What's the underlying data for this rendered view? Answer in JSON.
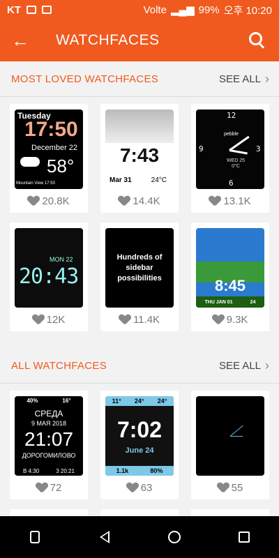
{
  "status": {
    "carrier": "KT",
    "network": "Volte",
    "battery": "99%",
    "time": "오후 10:20"
  },
  "appbar": {
    "title": "WATCHFACES",
    "back_icon": "arrow-left-icon",
    "search_icon": "search-icon"
  },
  "sections": {
    "loved": {
      "title": "MOST LOVED WATCHFACES",
      "see_all": "SEE ALL"
    },
    "all": {
      "title": "ALL WATCHFACES",
      "see_all": "SEE ALL"
    }
  },
  "loved_items": [
    {
      "likes": "20.8K",
      "face": {
        "day": "Tuesday",
        "time": "17:50",
        "date": "December 22",
        "temp": "58°",
        "location": "Mountain View 17:50"
      }
    },
    {
      "likes": "14.4K",
      "face": {
        "time": "7:43",
        "date": "Mar 31",
        "temp": "24°C"
      }
    },
    {
      "likes": "13.1K",
      "face": {
        "brand": "pebble",
        "date_line1": "WED 25",
        "date_line2": "0°C"
      }
    },
    {
      "likes": "12K",
      "face": {
        "top": "MON 22",
        "time": "20:43"
      }
    },
    {
      "likes": "11.4K",
      "face": {
        "text": "Hundreds of sidebar possibilities"
      }
    },
    {
      "likes": "9.3K",
      "face": {
        "time": "8:45",
        "date": "THU JAN 01",
        "num": "24"
      }
    }
  ],
  "all_items": [
    {
      "likes": "72",
      "face": {
        "battery": "40%",
        "temp": "16°",
        "city": "СРЕДА",
        "date": "9 МАЯ 2018",
        "time": "21:07",
        "area": "ДОРОГОМИЛОВО",
        "b": "B 4:30",
        "s": "3 20:21"
      }
    },
    {
      "likes": "63",
      "face": {
        "t1": "11°",
        "t2": "24°",
        "t3": "24°",
        "time": "7:02",
        "date": "June 24",
        "steps": "1.1k",
        "battery": "80%"
      }
    },
    {
      "likes": "55",
      "face": {}
    }
  ]
}
